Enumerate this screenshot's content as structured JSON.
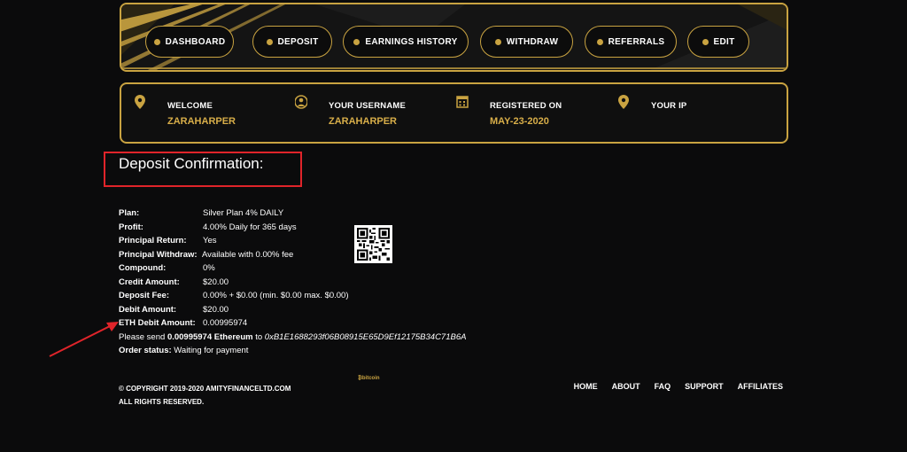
{
  "nav": {
    "items": [
      {
        "label": "DASHBOARD",
        "icon": "dashboard-icon"
      },
      {
        "label": "DEPOSIT",
        "icon": "deposit-icon"
      },
      {
        "label": "EARNINGS HISTORY",
        "icon": "earnings-icon"
      },
      {
        "label": "WITHDRAW",
        "icon": "wallet-icon"
      },
      {
        "label": "REFERRALS",
        "icon": "referrals-icon"
      },
      {
        "label": "EDIT",
        "icon": "gear-icon"
      }
    ]
  },
  "info": {
    "welcome_label": "WELCOME",
    "welcome_value": "ZARAHARPER",
    "username_label": "YOUR USERNAME",
    "username_value": "ZARAHARPER",
    "registered_label": "REGISTERED ON",
    "registered_value": "MAY-23-2020",
    "ip_label": "YOUR IP"
  },
  "page": {
    "title": "Deposit Confirmation:"
  },
  "details": {
    "rows": [
      {
        "key": "Plan:",
        "value": "Silver Plan 4% DAILY"
      },
      {
        "key": "Profit:",
        "value": "4.00% Daily for 365 days"
      },
      {
        "key": "Principal Return:",
        "value": "Yes"
      },
      {
        "key": "Principal Withdraw:",
        "value": "Available with 0.00% fee"
      },
      {
        "key": "Compound:",
        "value": "0%"
      },
      {
        "key": "Credit Amount:",
        "value": "$20.00"
      },
      {
        "key": "Deposit Fee:",
        "value": "0.00% + $0.00 (min. $0.00 max. $0.00)"
      },
      {
        "key": "Debit Amount:",
        "value": "$20.00"
      },
      {
        "key": "ETH Debit Amount:",
        "value": "0.00995974"
      }
    ],
    "send_prefix": "Please send ",
    "send_amount": "0.00995974 Ethereum",
    "send_to": " to ",
    "send_address": "0xB1E1688293f06B08915E65D9Ef12175B34C71B6A",
    "status_key": "Order status:",
    "status_value": "Waiting for payment"
  },
  "footer": {
    "copyright_line1": "© COPYRIGHT 2019-2020 AMITYFINANCELTD.COM",
    "copyright_line2": "ALL RIGHTS RESERVED.",
    "bitcoin_logo": "bitcoin",
    "links": [
      "HOME",
      "ABOUT",
      "FAQ",
      "SUPPORT",
      "AFFILIATES"
    ]
  },
  "colors": {
    "gold": "#c9a341",
    "gold_text": "#d8ae49",
    "annotation_red": "#e0242a",
    "background": "#0b0b0c"
  }
}
